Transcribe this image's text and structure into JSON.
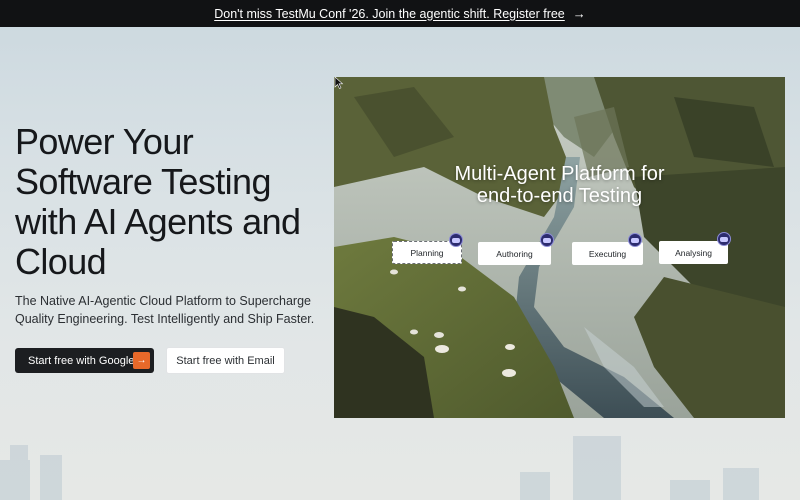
{
  "announcement": {
    "text": "Don't miss TestMu Conf '26. Join the agentic shift. Register free",
    "arrow_icon": "arrow-right-icon"
  },
  "hero": {
    "title": "Power Your Software Testing with AI Agents and Cloud",
    "subtitle": "The Native AI-Agentic Cloud Platform to Supercharge Quality Engineering. Test Intelligently and Ship Faster."
  },
  "buttons": {
    "google_label": "Start free with Google",
    "google_icon": "arrow-right-icon",
    "email_label": "Start free with Email"
  },
  "panel": {
    "title_line1": "Multi-Agent Platform for",
    "title_line2": "end-to-end Testing",
    "steps": [
      {
        "label": "Planning"
      },
      {
        "label": "Authoring"
      },
      {
        "label": "Executing"
      },
      {
        "label": "Analysing"
      }
    ]
  },
  "colors": {
    "announcement_bg": "#111214",
    "primary_button_bg": "#1c1e21",
    "accent_orange": "#e8692a",
    "agent_avatar": "#2d2c6f"
  }
}
